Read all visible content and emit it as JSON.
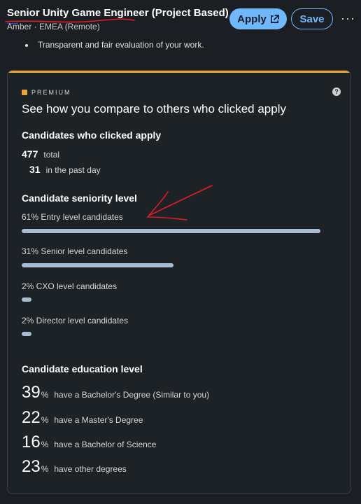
{
  "header": {
    "title_main": "Senior Unity Game Engineer",
    "title_suffix": " (Project Based)",
    "subtitle": "Amber · EMEA (Remote)",
    "apply_label": "Apply",
    "save_label": "Save",
    "more_label": "···"
  },
  "bullet_text": "Transparent and fair evaluation of your work.",
  "card": {
    "premium_label": "PREMIUM",
    "heading": "See how you compare to others who clicked apply",
    "help_glyph": "?",
    "applicants": {
      "heading": "Candidates who clicked apply",
      "total_value": "477",
      "total_label": "total",
      "past_day_value": "31",
      "past_day_label": "in the past day"
    },
    "seniority": {
      "heading": "Candidate seniority level",
      "items": [
        {
          "label": "61% Entry level candidates",
          "percent": 61
        },
        {
          "label": "31% Senior level candidates",
          "percent": 31
        },
        {
          "label": "2% CXO level candidates",
          "percent": 2
        },
        {
          "label": "2% Director level candidates",
          "percent": 2
        }
      ]
    },
    "education": {
      "heading": "Candidate education level",
      "items": [
        {
          "value": "39",
          "pct": "%",
          "label": "have a Bachelor's Degree (Similar to you)"
        },
        {
          "value": "22",
          "pct": "%",
          "label": "have a Master's Degree"
        },
        {
          "value": "16",
          "pct": "%",
          "label": "have a Bachelor of Science"
        },
        {
          "value": "23",
          "pct": "%",
          "label": "have other degrees"
        }
      ]
    }
  },
  "colors": {
    "accent": "#71b7fb",
    "premium": "#e7a33e",
    "bar": "#a9bdd2",
    "annotation": "#e01b24"
  }
}
